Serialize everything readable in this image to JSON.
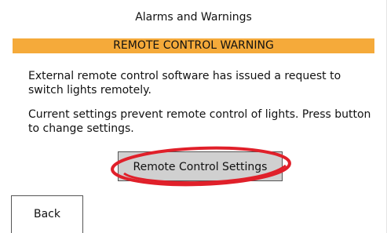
{
  "header": {
    "title": "Alarms and Warnings"
  },
  "warning": {
    "banner": "REMOTE CONTROL WARNING",
    "message_1": "External remote control software has issued a request to switch lights remotely.",
    "message_2": "Current settings prevent remote control of lights. Press button to change settings."
  },
  "actions": {
    "remote_settings_label": "Remote Control Settings",
    "back_label": "Back"
  },
  "colors": {
    "banner": "#f5aa3a",
    "highlight": "#e0202a"
  }
}
